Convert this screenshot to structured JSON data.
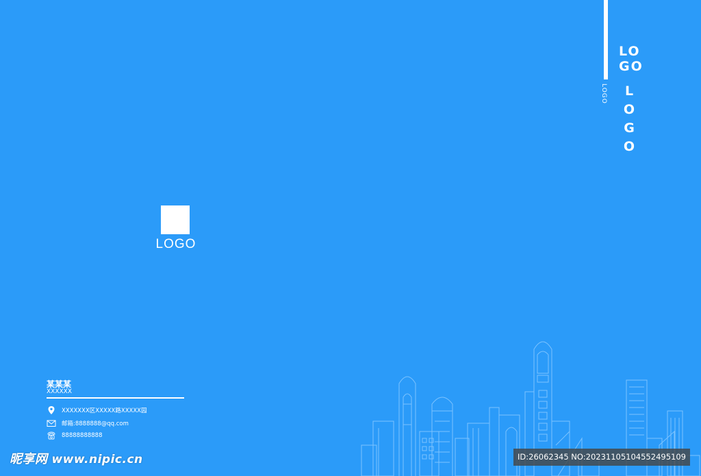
{
  "spine": {
    "small_text": "LOGO",
    "logo_line1": "LO",
    "logo_line2": "GO",
    "logo_vertical": [
      "L",
      "O",
      "G",
      "O"
    ]
  },
  "center_logo": {
    "text": "LOGO"
  },
  "contact": {
    "name": "某某某",
    "sub": "XXXXXX",
    "address": "XXXXXXX区XXXXX路XXXXX园",
    "email": "邮箱:8888888@qq.com",
    "phone": "88888888888",
    "icons": [
      "location-pin-icon",
      "mail-icon",
      "phone-icon"
    ]
  },
  "watermark": {
    "brand": "昵享网",
    "site": "www.nipic.cn"
  },
  "id_badge": {
    "text": "ID:26062345 NO:20231105104552495109"
  },
  "colors": {
    "background": "#2b9bf9",
    "foreground": "#ffffff",
    "skyline_line": "#7cc3ff",
    "badge_bg": "#464646"
  }
}
